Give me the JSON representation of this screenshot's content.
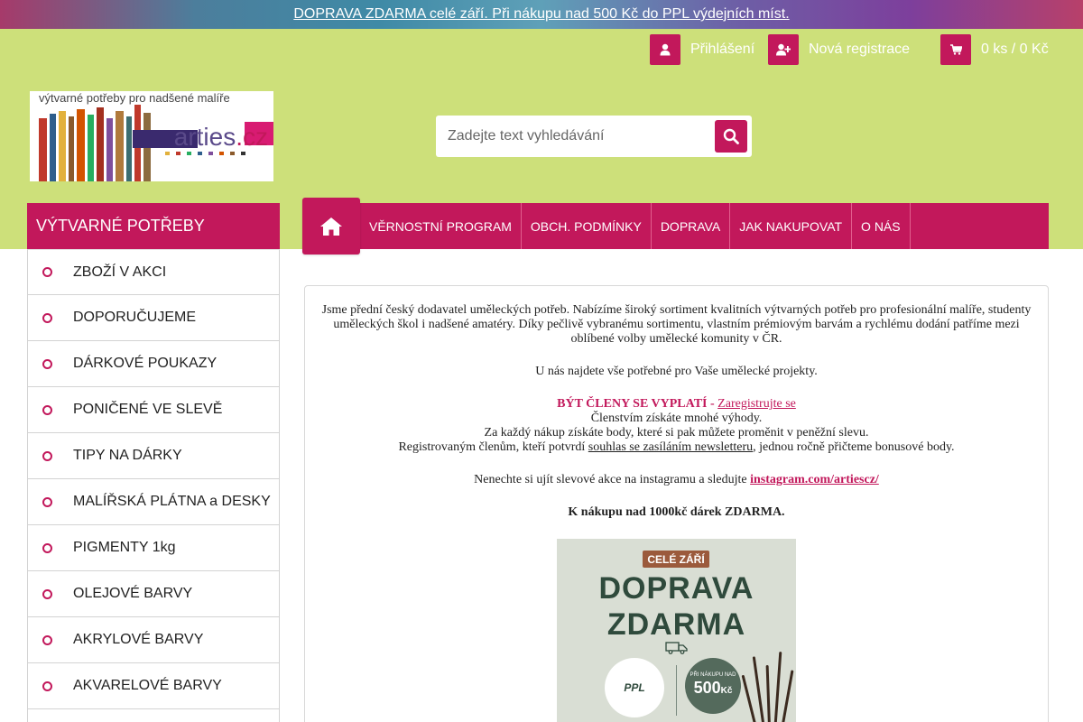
{
  "promo_banner": {
    "text": " DOPRAVA ZDARMA celé září. Při nákupu nad 500 Kč do PPL výdejních míst."
  },
  "header": {
    "login_label": "Přihlášení",
    "register_label": "Nová registrace",
    "cart_label": "0 ks / 0 Kč",
    "logo": {
      "tagline": "výtvarné potřeby pro nadšené malíře",
      "brand_main": "arties",
      "brand_tld": ".cz"
    },
    "search": {
      "placeholder": "Zadejte text vyhledávání",
      "value": ""
    }
  },
  "sidebar": {
    "title": "VÝTVARNÉ POTŘEBY",
    "items": [
      {
        "label": "ZBOŽÍ V AKCI"
      },
      {
        "label": "DOPORUČUJEME"
      },
      {
        "label": "DÁRKOVÉ POUKAZY"
      },
      {
        "label": "PONIČENÉ VE SLEVĚ"
      },
      {
        "label": "TIPY NA DÁRKY"
      },
      {
        "label": "MALÍŘSKÁ PLÁTNA a DESKY"
      },
      {
        "label": "PIGMENTY 1kg"
      },
      {
        "label": "OLEJOVÉ BARVY"
      },
      {
        "label": "AKRYLOVÉ BARVY"
      },
      {
        "label": "AKVARELOVÉ BARVY"
      },
      {
        "label": ""
      }
    ]
  },
  "nav": {
    "items": [
      {
        "label": "VĚRNOSTNÍ PROGRAM"
      },
      {
        "label": "OBCH. PODMÍNKY"
      },
      {
        "label": "DOPRAVA"
      },
      {
        "label": "JAK NAKUPOVAT"
      },
      {
        "label": "O NÁS"
      }
    ]
  },
  "content": {
    "intro": "Jsme přední český dodavatel uměleckých potřeb. Nabízíme široký sortiment kvalitních výtvarných potřeb pro profesionální malíře, studenty uměleckých škol i nadšené amatéry. Díky pečlivě vybranému sortimentu, vlastním prémiovým barvám a rychlému dodání patříme mezi oblíbené volby umělecké komunity v ČR.",
    "p2": "U nás najdete vše potřebné pro Vaše umělecké projekty.",
    "member_headline": "BÝT ČLENY SE VYPLATÍ",
    "member_dash": " - ",
    "member_link": "Zaregistrujte se",
    "member_line1": "Členstvím získáte mnohé výhody.",
    "member_line2": "Za každý nákup získáte body, které si pak můžete proměnit v peněžní slevu.",
    "member_line3_pre": "Registrovaným členům, kteří potvrdí ",
    "member_line3_link": "souhlas se zasíláním newsletteru",
    "member_line3_post": ", jednou ročně přičteme bonusové body.",
    "insta_pre": "Nenechte si ujít slevové akce na instagramu a sledujte ",
    "insta_link": "instagram.com/artiescz/",
    "gift": "K nákupu nad 1000kč dárek ZDARMA."
  },
  "promo_image": {
    "badge": "CELÉ ZÁŘÍ",
    "line1": "DOPRAVA",
    "line2": "ZDARMA",
    "ppl": "PPL",
    "small": "PŘI NÁKUPU NAD",
    "amount": "500",
    "currency": "Kč"
  },
  "colors": {
    "accent": "#c2185b",
    "header_band": "#cde07a"
  }
}
